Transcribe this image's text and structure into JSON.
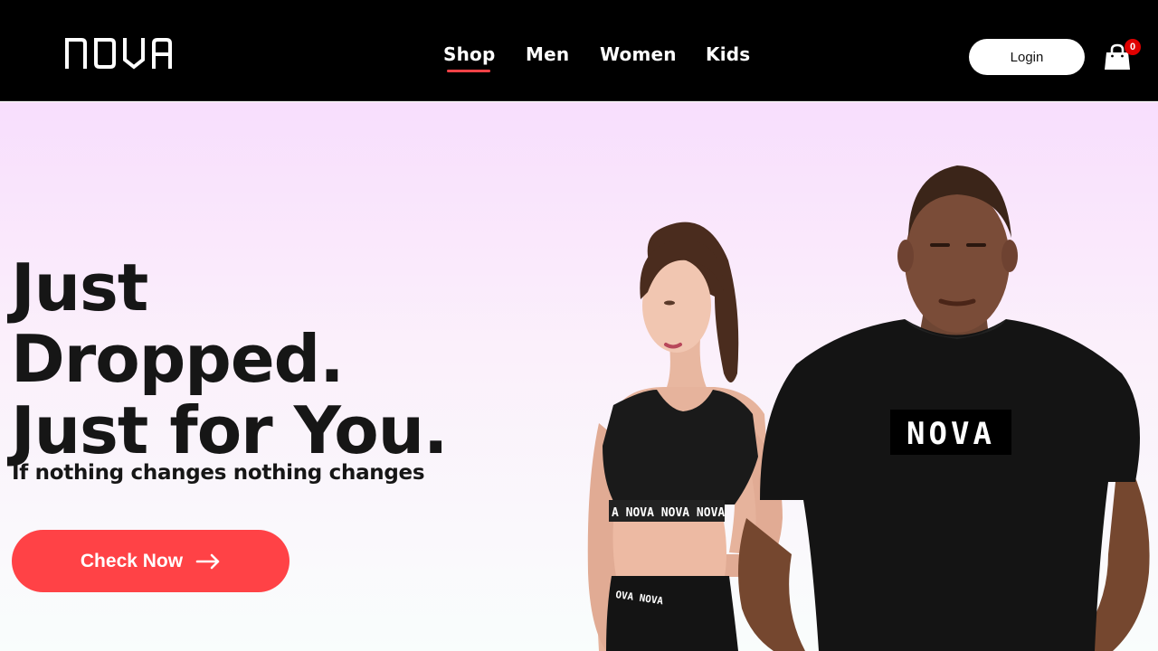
{
  "brand": {
    "logo_text": "NOVA"
  },
  "nav": {
    "items": [
      {
        "label": "Shop",
        "active": true
      },
      {
        "label": "Men",
        "active": false
      },
      {
        "label": "Women",
        "active": false
      },
      {
        "label": "Kids",
        "active": false
      }
    ]
  },
  "header": {
    "login_label": "Login",
    "cart_count": "0",
    "cart_icon": "shopping-bag-icon"
  },
  "hero": {
    "headline_line1": "Just",
    "headline_line2": "Dropped.",
    "headline_line3": "Just for You.",
    "tagline": "If nothing changes nothing changes",
    "cta_label": "Check Now",
    "cta_icon": "arrow-right-icon",
    "shirt_print": "NOVA",
    "waistband_print": "A NOVA NOVA NOVA",
    "leggings_print": "OVA NOVA"
  },
  "colors": {
    "accent": "#ff4246",
    "header_bg": "#000000",
    "hero_gradient_top": "#f8defd",
    "hero_gradient_bottom": "#f9fdfc",
    "text": "#161616",
    "badge": "#e00000"
  }
}
